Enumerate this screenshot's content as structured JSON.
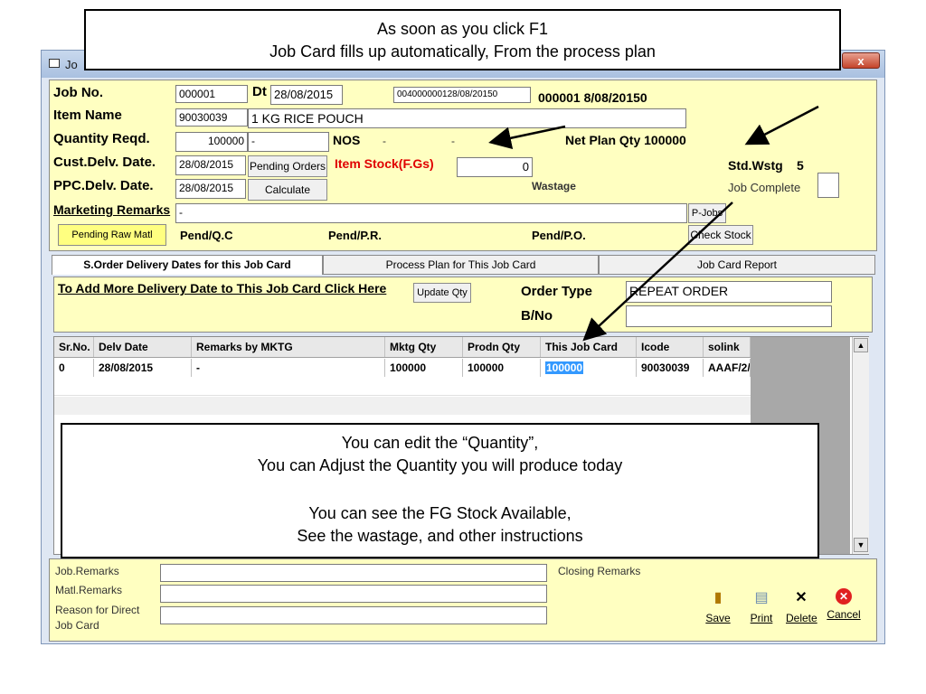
{
  "window": {
    "title": "Jo",
    "close_label": "x"
  },
  "callout_top": {
    "line1": "As soon as you click F1",
    "line2": "Job Card fills up automatically, From the process plan"
  },
  "header": {
    "job_no_label": "Job No.",
    "job_no": "000001",
    "dt_label": "Dt",
    "dt_value": "28/08/2015",
    "ref_code": "004000000128/08/20150",
    "ref_display": "000001 8/08/20150",
    "item_name_label": "Item Name",
    "item_code": "90030039",
    "item_desc": "1 KG RICE POUCH",
    "qty_label": "Quantity Reqd.",
    "qty_value": "100000",
    "qty_suffix": "-",
    "nos_label": "NOS",
    "nos_dash1": "-",
    "nos_dash2": "-",
    "net_plan": "Net Plan Qty 100000",
    "cust_delv_label": "Cust.Delv. Date.",
    "cust_delv": "28/08/2015",
    "pending_orders": "Pending Orders",
    "item_stock_label": "Item Stock(F.Gs)",
    "item_stock": "0",
    "std_wstg_label": "Std.Wstg",
    "std_wstg": "5",
    "ppc_delv_label": "PPC.Delv. Date.",
    "ppc_delv": "28/08/2015",
    "calculate": "Calculate",
    "wastage_label": "Wastage",
    "job_complete_label": "Job Complete",
    "mkt_remarks_label": "Marketing Remarks",
    "mkt_remarks_value": "-",
    "pjobs": "P-Jobs",
    "pending_raw": "Pending Raw Matl",
    "pend_qc": "Pend/Q.C",
    "pend_pr": "Pend/P.R.",
    "pend_po": "Pend/P.O.",
    "check_stock": "Check Stock"
  },
  "tabs": [
    {
      "label": "S.Order Delivery Dates for this Job Card",
      "active": true
    },
    {
      "label": "Process Plan for This Job Card",
      "active": false
    },
    {
      "label": "Job Card Report",
      "active": false
    }
  ],
  "order": {
    "add_link": "To Add More Delivery Date to This Job Card Click Here",
    "update_qty": "Update Qty",
    "order_type_label": "Order Type",
    "order_type": "REPEAT ORDER",
    "bno_label": "B/No",
    "bno": ""
  },
  "grid": {
    "columns": [
      "Sr.No.",
      "Delv Date",
      "Remarks by MKTG",
      "Mktg Qty",
      "Prodn Qty",
      "This Job Card",
      "Icode",
      "solink"
    ],
    "rows": [
      [
        "0",
        "28/08/2015",
        "-",
        "100000",
        "100000",
        "100000",
        "90030039",
        "AAAF/2/"
      ]
    ],
    "scroll_up": "▲",
    "scroll_down": "▼"
  },
  "callout_mid": {
    "line1": "You can edit the “Quantity”,",
    "line2": "You can Adjust the Quantity you will produce today",
    "line3": "You can see the  FG Stock Available,",
    "line4": "See the wastage, and other instructions"
  },
  "bottom": {
    "job_remarks_label": "Job.Remarks",
    "matl_remarks_label": "Matl.Remarks",
    "reason_label_1": "Reason for Direct",
    "reason_label_2": "Job Card",
    "closing_remarks_label": "Closing Remarks",
    "save": "Save",
    "print": "Print",
    "delete": "Delete",
    "cancel": "Cancel"
  },
  "colors": {
    "panel": "#ffffc1",
    "window": "#dfe7f3",
    "stock_red": "#e00000",
    "highlight": "#3399ff"
  }
}
